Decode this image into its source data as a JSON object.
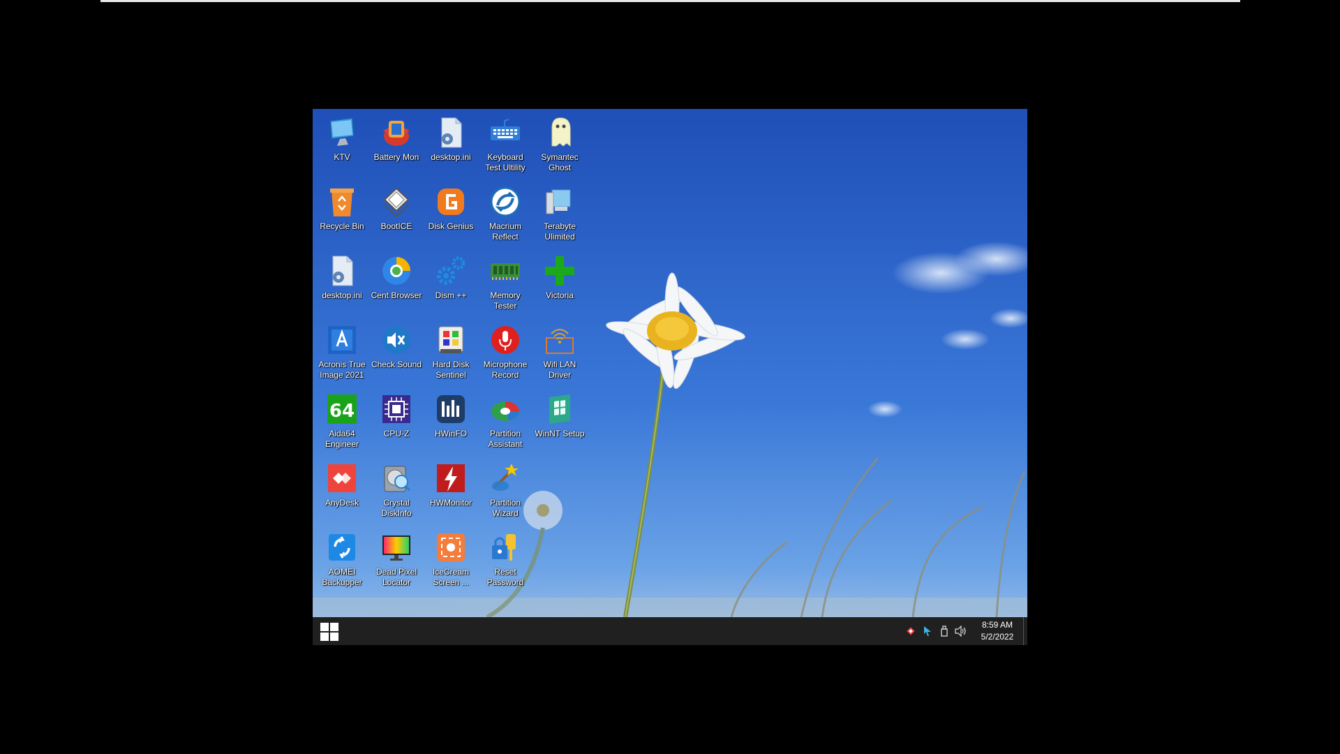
{
  "desktop_icons": [
    {
      "label": "KTV",
      "icon": "monitor-icon"
    },
    {
      "label": "Battery Mon",
      "icon": "battery-mon-icon"
    },
    {
      "label": "desktop.ini",
      "icon": "settings-file-icon"
    },
    {
      "label": "Keyboard Test Ultility",
      "icon": "keyboard-icon"
    },
    {
      "label": "Symantec Ghost",
      "icon": "ghost-icon"
    },
    {
      "label": "Recycle Bin",
      "icon": "recycle-bin-icon"
    },
    {
      "label": "BootICE",
      "icon": "bootice-icon"
    },
    {
      "label": "Disk Genius",
      "icon": "disk-genius-icon"
    },
    {
      "label": "Macrium Reflect",
      "icon": "macrium-icon"
    },
    {
      "label": "Terabyte Ulimited",
      "icon": "terabyte-icon"
    },
    {
      "label": "desktop.ini",
      "icon": "settings-file-icon"
    },
    {
      "label": "Cent Browser",
      "icon": "browser-icon"
    },
    {
      "label": "Dism ++",
      "icon": "gears-icon"
    },
    {
      "label": "Memory Tester",
      "icon": "memory-icon"
    },
    {
      "label": "Victoria",
      "icon": "green-cross-icon"
    },
    {
      "label": "Acronis True Image 2021",
      "icon": "acronis-icon"
    },
    {
      "label": "Check Sound",
      "icon": "sound-icon"
    },
    {
      "label": "Hard Disk Sentinel",
      "icon": "hdd-sentinel-icon"
    },
    {
      "label": "Microphone Record",
      "icon": "microphone-icon"
    },
    {
      "label": "Wifi LAN Driver",
      "icon": "wifi-icon"
    },
    {
      "label": "Aida64 Engineer",
      "icon": "aida64-icon"
    },
    {
      "label": "CPU-Z",
      "icon": "cpu-icon"
    },
    {
      "label": "HWinFO",
      "icon": "hwinfo-icon"
    },
    {
      "label": "Partition Assistant",
      "icon": "partition-assistant-icon"
    },
    {
      "label": "WinNT Setup",
      "icon": "winnt-icon"
    },
    {
      "label": "AnyDesk",
      "icon": "anydesk-icon"
    },
    {
      "label": "Crystal DiskInfo",
      "icon": "crystal-diskinfo-icon"
    },
    {
      "label": "HWMonitor",
      "icon": "hwmonitor-icon"
    },
    {
      "label": "Partition Wizard",
      "icon": "partition-wizard-icon"
    },
    {
      "label": "",
      "icon": ""
    },
    {
      "label": "AOMEI Backupper",
      "icon": "aomei-icon"
    },
    {
      "label": "Dead Pixel Locator",
      "icon": "dead-pixel-icon"
    },
    {
      "label": "IceCream Screen ...",
      "icon": "icecream-icon"
    },
    {
      "label": "Reset Password",
      "icon": "password-icon"
    }
  ],
  "taskbar": {
    "start_icon": "windows-start-icon",
    "tray_icons": [
      "anydesk-tray-icon",
      "cursor-tray-icon",
      "usb-tray-icon",
      "volume-icon"
    ],
    "time": "8:59 AM",
    "date": "5/2/2022",
    "background": "#202020"
  },
  "colors": {
    "sky": "#2e63c9",
    "taskbar": "#202020"
  }
}
